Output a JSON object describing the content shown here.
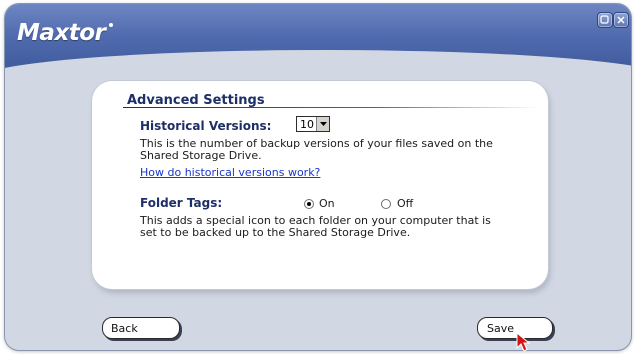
{
  "app": {
    "brand": "Maxtor"
  },
  "window_controls": {
    "minimize": "minimize-icon",
    "close": "close-icon"
  },
  "settings": {
    "title": "Advanced Settings",
    "historical_versions": {
      "label": "Historical Versions:",
      "value": "10",
      "description_line1": "This is the number of backup versions of your files saved on the",
      "description_line2": "Shared Storage Drive.",
      "help_link": "How do historical versions work?"
    },
    "folder_tags": {
      "label": "Folder Tags:",
      "option_on": "On",
      "option_off": "Off",
      "selected": "On",
      "description_line1": "This adds a special icon to each folder on your computer that is",
      "description_line2": "set to be backed up to the Shared Storage Drive."
    }
  },
  "footer": {
    "back_label": "Back",
    "save_label": "Save"
  },
  "colors": {
    "title_bar": "#4f6aae",
    "heading": "#1e2f68",
    "link": "#1a36c8",
    "window_bg": "#d2d8e3"
  }
}
